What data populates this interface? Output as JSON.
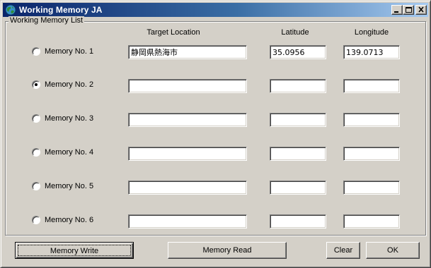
{
  "window": {
    "title": "Working Memory JA",
    "icon": "globe-icon"
  },
  "group": {
    "legend": "Working Memory List"
  },
  "columns": {
    "location": "Target Location",
    "latitude": "Latitude",
    "longitude": "Longitude"
  },
  "memories": [
    {
      "label": "Memory No. 1",
      "checked": false,
      "location": "静岡県熱海市",
      "latitude": "35.0956",
      "longitude": "139.0713"
    },
    {
      "label": "Memory No. 2",
      "checked": true,
      "location": "",
      "latitude": "",
      "longitude": ""
    },
    {
      "label": "Memory No. 3",
      "checked": false,
      "location": "",
      "latitude": "",
      "longitude": ""
    },
    {
      "label": "Memory No. 4",
      "checked": false,
      "location": "",
      "latitude": "",
      "longitude": ""
    },
    {
      "label": "Memory No. 5",
      "checked": false,
      "location": "",
      "latitude": "",
      "longitude": ""
    },
    {
      "label": "Memory No. 6",
      "checked": false,
      "location": "",
      "latitude": "",
      "longitude": ""
    }
  ],
  "buttons": {
    "write": "Memory Write",
    "read": "Memory Read",
    "clear": "Clear",
    "ok": "OK"
  }
}
